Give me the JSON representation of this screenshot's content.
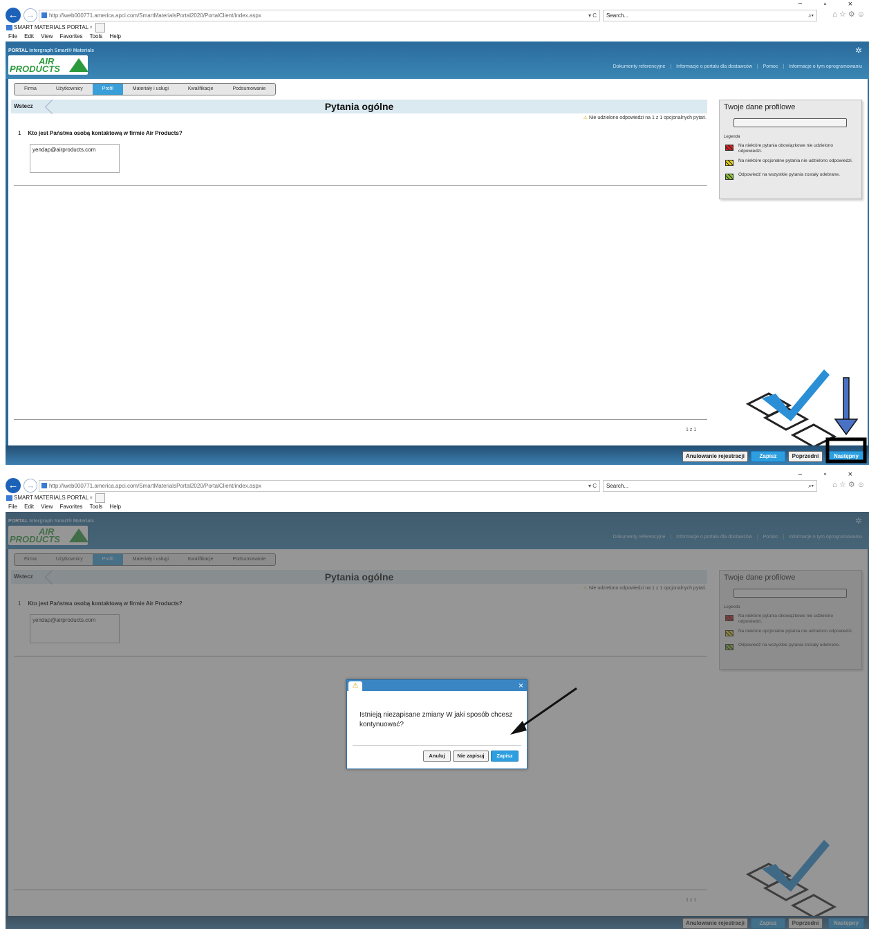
{
  "browser": {
    "url": "http://iweb000771.america.apci.com/SmartMaterialsPortal2020/PortalClient/index.aspx",
    "url_dropdown": "▾ C",
    "search_placeholder": "Search...",
    "tab_title": "SMART MATERIALS PORTAL",
    "tab_close": "×",
    "menu": [
      "File",
      "Edit",
      "View",
      "Favorites",
      "Tools",
      "Help"
    ],
    "window_controls": "− ▫ ×",
    "toolbar_icons": "⌂ ☆ ⚙ ☺"
  },
  "portal": {
    "label_a": "PORTAL",
    "label_b": "Intergraph Smart® Materials",
    "logo_line1": "AIR",
    "logo_line2": "PRODUCTS",
    "links": [
      "Dokumenty referencyjne",
      "Informacje o portalu dla dostawców",
      "Pomoc",
      "Informacje o tym oprogramowaniu"
    ],
    "link_separator": "|"
  },
  "wizard": {
    "steps": [
      "Firma",
      "Użytkownicy",
      "Profil",
      "Materiały i usługi",
      "Kwalifikacje",
      "Podsumowanie"
    ],
    "active_step": "Profil"
  },
  "content": {
    "back": "Wstecz",
    "title": "Pytania ogólne",
    "warning": "Nie udzielono odpowiedzi na 1 z 1 opcjonalnych pytań.",
    "question_number": "1",
    "question": "Kto jest Państwa osobą kontaktową w firmie Air Products?",
    "answer": "yendap@airproducts.com",
    "pagination": "1 z 1"
  },
  "profile_panel": {
    "title": "Twoje dane profilowe",
    "legend_title": "Legenda",
    "legend": [
      {
        "text": "Na niektóre pytania obowiązkowe nie udzielono odpowiedzi.",
        "color": "#d32020"
      },
      {
        "text": "Na niektóre opcjonalne pytania nie udzielono odpowiedzi.",
        "color": "#e6d21a"
      },
      {
        "text": "Odpowiedź na wszystkie pytania zostały odebrane.",
        "color": "#8fc23a"
      }
    ]
  },
  "footer": {
    "cancel": "Anulowanie rejestracji",
    "save": "Zapisz",
    "previous": "Poprzedni",
    "next": "Następny"
  },
  "dialog": {
    "message": "Istnieją niezapisane zmiany W jaki sposób chcesz kontynuować?",
    "close": "×",
    "warning_icon": "⚠",
    "buttons": {
      "cancel": "Anuluj",
      "dont_save": "Nie zapisuj",
      "save": "Zapisz"
    }
  },
  "colors": {
    "accent_blue": "#2d9fe0",
    "header_blue": "#2c6897",
    "annotation_arrow": "#4a72c4"
  }
}
